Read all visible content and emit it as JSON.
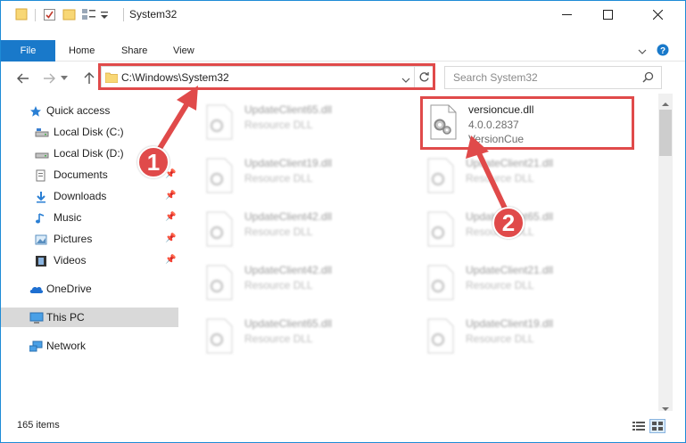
{
  "window": {
    "title": "System32"
  },
  "ribbon": {
    "tabs": [
      "File",
      "Home",
      "Share",
      "View"
    ]
  },
  "address": {
    "path": "C:\\Windows\\System32"
  },
  "search": {
    "placeholder": "Search System32"
  },
  "sidebar": {
    "items": [
      {
        "label": "Quick access",
        "icon": "star-icon",
        "pinned": false
      },
      {
        "label": "Local Disk (C:)",
        "icon": "drive-icon",
        "pinned": false
      },
      {
        "label": "Local Disk (D:)",
        "icon": "drive-icon",
        "pinned": false
      },
      {
        "label": "Documents",
        "icon": "documents-icon",
        "pinned": true
      },
      {
        "label": "Downloads",
        "icon": "downloads-icon",
        "pinned": true
      },
      {
        "label": "Music",
        "icon": "music-icon",
        "pinned": true
      },
      {
        "label": "Pictures",
        "icon": "pictures-icon",
        "pinned": true
      },
      {
        "label": "Videos",
        "icon": "videos-icon",
        "pinned": true
      },
      {
        "label": "OneDrive",
        "icon": "onedrive-icon",
        "pinned": false
      },
      {
        "label": "This PC",
        "icon": "computer-icon",
        "pinned": false,
        "selected": true
      },
      {
        "label": "Network",
        "icon": "network-icon",
        "pinned": false
      }
    ]
  },
  "files": [
    {
      "name": "UpdateClient65.dll",
      "desc": "Resource DLL"
    },
    {
      "name": "versioncue.dll",
      "desc": "4.0.0.2837",
      "sub": "VersionCue"
    },
    {
      "name": "UpdateClient19.dll",
      "desc": "Resource DLL"
    },
    {
      "name": "UpdateClient21.dll",
      "desc": "Resource DLL"
    },
    {
      "name": "UpdateClient42.dll",
      "desc": "Resource DLL"
    },
    {
      "name": "UpdateClient65.dll",
      "desc": "Resource DLL"
    },
    {
      "name": "UpdateClient42.dll",
      "desc": "Resource DLL"
    },
    {
      "name": "UpdateClient21.dll",
      "desc": "Resource DLL"
    },
    {
      "name": "UpdateClient65.dll",
      "desc": "Resource DLL"
    },
    {
      "name": "UpdateClient19.dll",
      "desc": "Resource DLL"
    }
  ],
  "status": {
    "item_count": "165 items"
  },
  "annotations": {
    "badge1": "1",
    "badge2": "2",
    "color": "#e04a4a"
  },
  "colors": {
    "accent": "#1979ca",
    "highlight": "#e04a4a"
  }
}
